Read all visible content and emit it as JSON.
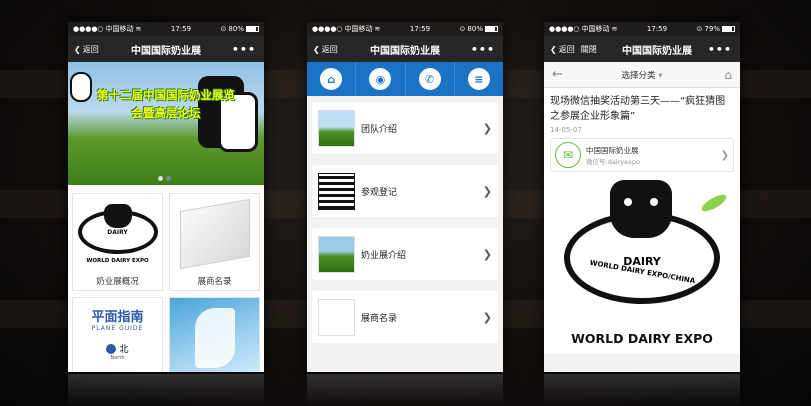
{
  "status": {
    "carrier": "中国移动",
    "time": "17:59",
    "battery_1": "80%",
    "battery_2": "80%",
    "battery_3": "79%"
  },
  "phone1": {
    "back_label": "返回",
    "title": "中国国际奶业展",
    "more": "•••",
    "banner_text": "第十二届中国国际奶业展览会暨高层论坛",
    "tiles": [
      {
        "label": "奶业展概况"
      },
      {
        "label": "展商名录"
      },
      {
        "label": ""
      },
      {
        "label": ""
      }
    ],
    "plane_guide_cn": "平面指南",
    "plane_guide_en": "PLANE GUIDE",
    "north_label": "北",
    "north_sub": "North",
    "logo_dairy": "DAIRY",
    "logo_ring": "WORLD DAIRY EXPO/CHINA",
    "logo_expo": "WORLD DAIRY EXPO"
  },
  "phone2": {
    "back_label": "返回",
    "title": "中国国际奶业展",
    "more": "•••",
    "icons": [
      "home-icon",
      "location-icon",
      "phone-icon",
      "list-icon"
    ],
    "menu": [
      {
        "label": "团队介绍"
      },
      {
        "label": "参观登记"
      },
      {
        "label": "奶业展介绍"
      },
      {
        "label": "展商名录"
      }
    ]
  },
  "phone3": {
    "back_label": "返回",
    "close_label": "關閉",
    "title": "中国国际奶业展",
    "more": "•••",
    "category": "选择分类",
    "article_title": "现场微信抽奖活动第三天——“疯狂猜图之参展企业形象篇”",
    "date": "14-05-07",
    "account_name": "中国国际奶业展",
    "account_id": "微信号:dairyexpo",
    "logo_dairy": "DAIRY",
    "logo_ring": "WORLD DAIRY EXPO/CHINA",
    "logo_expo": "WORLD DAIRY EXPO"
  }
}
